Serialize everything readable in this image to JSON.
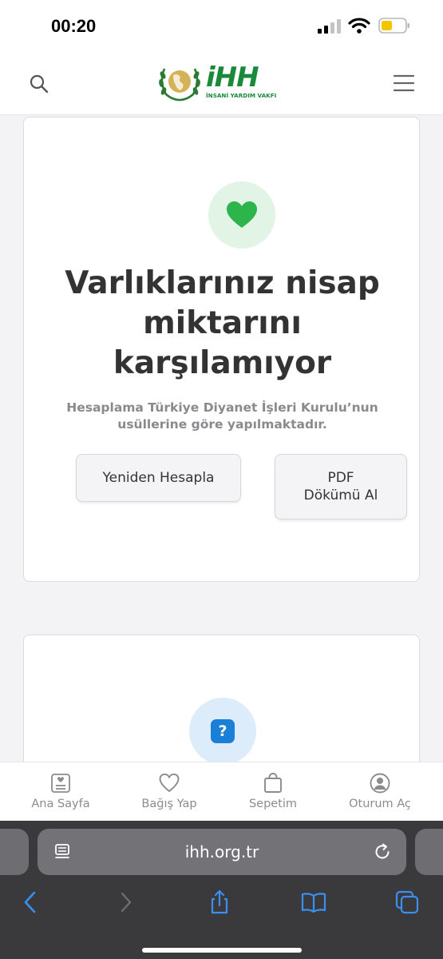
{
  "status_bar": {
    "time": "00:20"
  },
  "header": {
    "logo_word": "iHH",
    "logo_subtitle": "İNSANİ YARDIM VAKFI",
    "search_icon": "search-icon",
    "menu_icon": "menu-icon"
  },
  "result_card": {
    "icon": "heart-icon",
    "title": "Varlıklarınız nisap miktarını karşılamıyor",
    "note": "Hesaplama Türkiye Diyanet İşleri Kurulu’nun usüllerine göre yapılmaktadır.",
    "recalc_label": "Yeniden Hesapla",
    "pdf_label_line1": "PDF",
    "pdf_label_line2": "Dökümü Al"
  },
  "faq_card": {
    "icon": "question-icon",
    "icon_text": "?"
  },
  "bottom_nav": {
    "items": [
      {
        "label": "Ana Sayfa",
        "icon": "home-icon"
      },
      {
        "label": "Bağış Yap",
        "icon": "heart-outline-icon"
      },
      {
        "label": "Sepetim",
        "icon": "bag-icon"
      },
      {
        "label": "Oturum Aç",
        "icon": "user-icon"
      }
    ]
  },
  "browser": {
    "url": "ihh.org.tr",
    "toolbar": [
      "back-icon",
      "forward-icon",
      "share-icon",
      "bookmarks-icon",
      "tabs-icon"
    ]
  },
  "colors": {
    "brand_green": "#1a8a3a",
    "heart_green": "#2db44a",
    "accent_blue": "#1a7fd6",
    "browser_blue": "#3a8ff0"
  }
}
